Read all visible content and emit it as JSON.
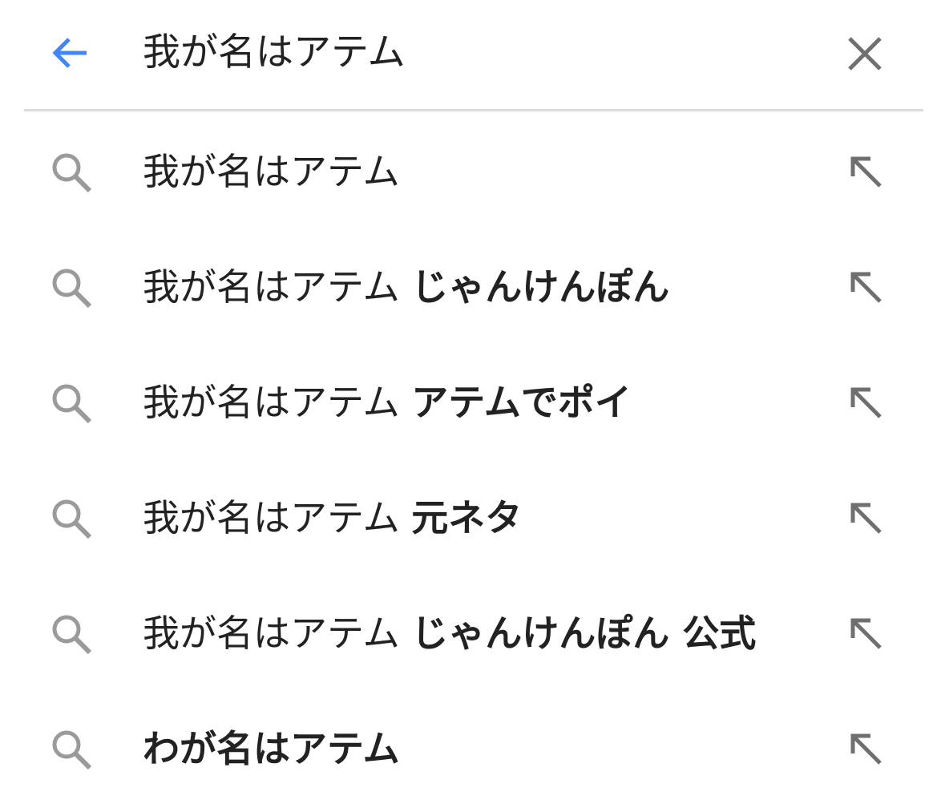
{
  "search": {
    "query": "我が名はアテム",
    "placeholder": ""
  },
  "header": {
    "back_icon": "arrow-left-icon",
    "clear_icon": "close-icon",
    "accent_color": "#4285f4",
    "icon_color": "#6f6f6f"
  },
  "suggestions": [
    {
      "prefix": "我が名はアテム",
      "suffix": "",
      "icon": "search-icon",
      "fill_icon": "arrow-up-left-icon"
    },
    {
      "prefix": "我が名はアテム ",
      "suffix": "じゃんけんぽん",
      "icon": "search-icon",
      "fill_icon": "arrow-up-left-icon"
    },
    {
      "prefix": "我が名はアテム ",
      "suffix": "アテムでポイ",
      "icon": "search-icon",
      "fill_icon": "arrow-up-left-icon"
    },
    {
      "prefix": "我が名はアテム ",
      "suffix": "元ネタ",
      "icon": "search-icon",
      "fill_icon": "arrow-up-left-icon"
    },
    {
      "prefix": "我が名はアテム ",
      "suffix": "じゃんけんぽん 公式",
      "icon": "search-icon",
      "fill_icon": "arrow-up-left-icon"
    },
    {
      "prefix": "",
      "suffix": "わが名はアテム",
      "icon": "search-icon",
      "fill_icon": "arrow-up-left-icon"
    }
  ]
}
